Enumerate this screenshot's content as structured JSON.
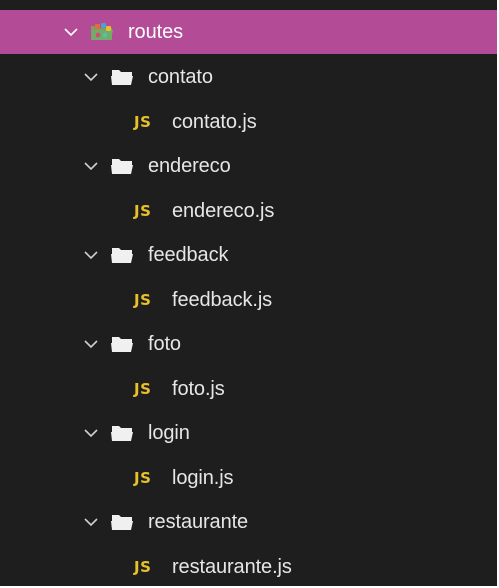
{
  "tree": {
    "root": {
      "label": "routes",
      "icon": "routes-folder-icon",
      "expanded": true
    },
    "folders": [
      {
        "label": "contato",
        "icon": "folder-open-icon",
        "expanded": true,
        "file": {
          "label": "contato.js",
          "badge": "JS"
        }
      },
      {
        "label": "endereco",
        "icon": "folder-open-icon",
        "expanded": true,
        "file": {
          "label": "endereco.js",
          "badge": "JS"
        }
      },
      {
        "label": "feedback",
        "icon": "folder-open-icon",
        "expanded": true,
        "file": {
          "label": "feedback.js",
          "badge": "JS"
        }
      },
      {
        "label": "foto",
        "icon": "folder-open-icon",
        "expanded": true,
        "file": {
          "label": "foto.js",
          "badge": "JS"
        }
      },
      {
        "label": "login",
        "icon": "folder-open-icon",
        "expanded": true,
        "file": {
          "label": "login.js",
          "badge": "JS"
        }
      },
      {
        "label": "restaurante",
        "icon": "folder-open-icon",
        "expanded": true,
        "file": {
          "label": "restaurante.js",
          "badge": "JS"
        }
      }
    ]
  },
  "colors": {
    "background": "#1e1e1e",
    "selected_row": "#b34b97",
    "text": "#e6e6e6",
    "js_badge": "#e8c02a",
    "folder": "#f0f0f0"
  }
}
